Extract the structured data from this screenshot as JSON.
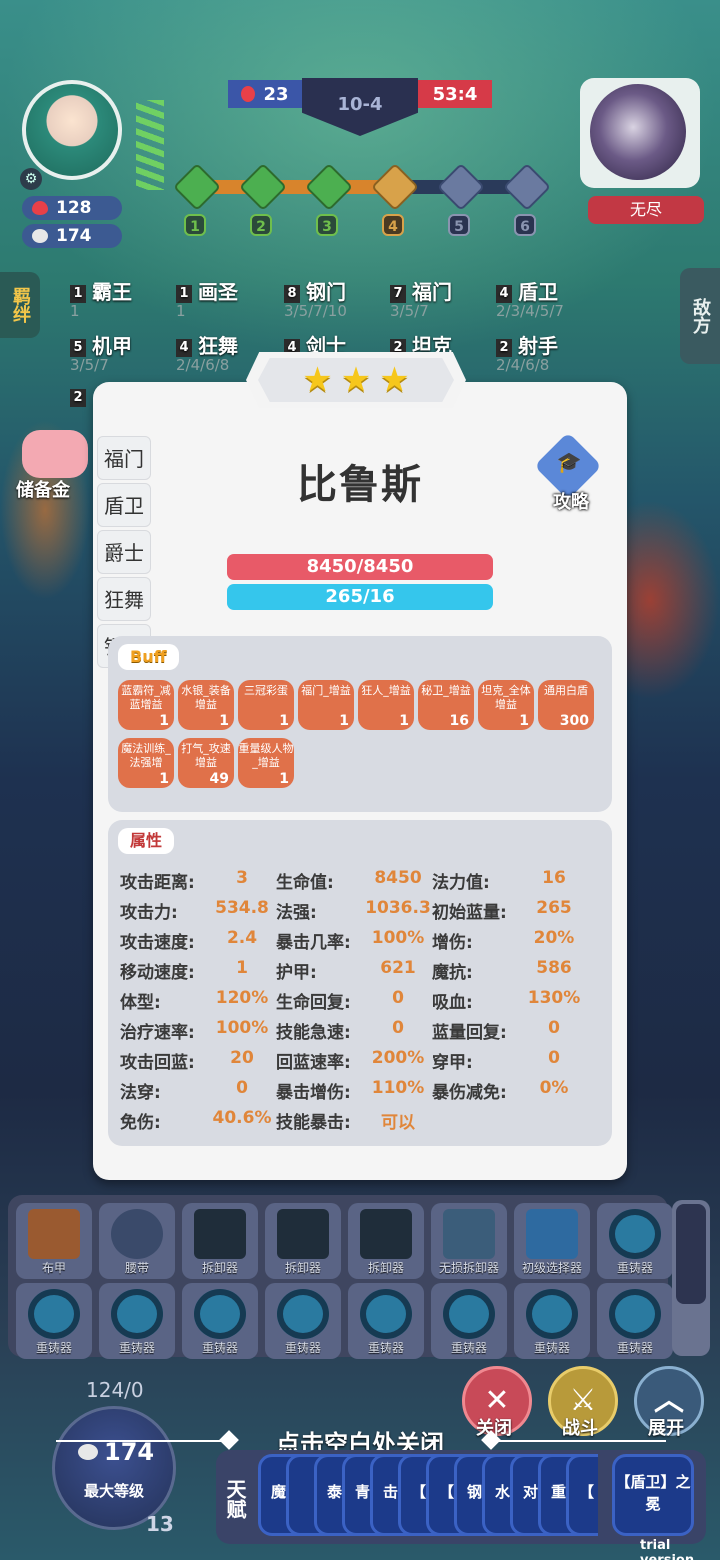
{
  "top": {
    "player": {
      "health": "128",
      "gold": "174"
    },
    "score_left": "23",
    "round": "10-4",
    "score_right": "53:4",
    "stages": [
      "1",
      "2",
      "3",
      "4",
      "5",
      "6"
    ],
    "enemy_name": "无尽"
  },
  "side": {
    "left_label": "羁绊",
    "right_label": "敌方"
  },
  "synergies": [
    {
      "count": "1",
      "name": "霸王",
      "sub": "1"
    },
    {
      "count": "1",
      "name": "画圣",
      "sub": "1"
    },
    {
      "count": "8",
      "name": "钢门",
      "sub": "3/5/7/10"
    },
    {
      "count": "7",
      "name": "福门",
      "sub": "3/5/7"
    },
    {
      "count": "4",
      "name": "盾卫",
      "sub": "2/3/4/5/7"
    },
    {
      "count": "5",
      "name": "机甲",
      "sub": "3/5/7"
    },
    {
      "count": "4",
      "name": "狂舞",
      "sub": "2/4/6/8"
    },
    {
      "count": "4",
      "name": "剑士",
      "sub": ""
    },
    {
      "count": "2",
      "name": "坦克",
      "sub": ""
    },
    {
      "count": "2",
      "name": "射手",
      "sub": "2/4/6/8"
    }
  ],
  "extra_count": "2",
  "piggy_label": "储备金",
  "modal": {
    "tabs": [
      "福门",
      "盾卫",
      "爵士",
      "狂舞",
      "钢门"
    ],
    "hero_name": "比鲁斯",
    "strategy_label": "攻略",
    "hp": "8450/8450",
    "mp": "265/16",
    "buff_title": "Buff",
    "buffs": [
      {
        "name": "蓝霸符_减蓝增益",
        "count": "1"
      },
      {
        "name": "水银_装备增益",
        "count": "1"
      },
      {
        "name": "三冠彩蛋",
        "count": "1"
      },
      {
        "name": "福门_增益",
        "count": "1"
      },
      {
        "name": "狂人_增益",
        "count": "1"
      },
      {
        "name": "秘卫_增益",
        "count": "16"
      },
      {
        "name": "坦克_全体增益",
        "count": "1"
      },
      {
        "name": "通用白盾",
        "count": "300"
      },
      {
        "name": "魔法训练_法强增",
        "count": "1"
      },
      {
        "name": "打气_攻速增益",
        "count": "49"
      },
      {
        "name": "重量级人物_增益",
        "count": "1"
      }
    ],
    "attr_title": "属性",
    "attributes": [
      [
        {
          "k": "攻击距离:",
          "v": "3"
        },
        {
          "k": "生命值:",
          "v": "8450"
        },
        {
          "k": "法力值:",
          "v": "16"
        }
      ],
      [
        {
          "k": "攻击力:",
          "v": "534.8"
        },
        {
          "k": "法强:",
          "v": "1036.3"
        },
        {
          "k": "初始蓝量:",
          "v": "265"
        }
      ],
      [
        {
          "k": "攻击速度:",
          "v": "2.4"
        },
        {
          "k": "暴击几率:",
          "v": "100%"
        },
        {
          "k": "增伤:",
          "v": "20%"
        }
      ],
      [
        {
          "k": "移动速度:",
          "v": "1"
        },
        {
          "k": "护甲:",
          "v": "621"
        },
        {
          "k": "魔抗:",
          "v": "586"
        }
      ],
      [
        {
          "k": "体型:",
          "v": "120%"
        },
        {
          "k": "生命回复:",
          "v": "0"
        },
        {
          "k": "吸血:",
          "v": "130%"
        }
      ],
      [
        {
          "k": "治疗速率:",
          "v": "100%"
        },
        {
          "k": "技能急速:",
          "v": "0"
        },
        {
          "k": "蓝量回复:",
          "v": "0"
        }
      ],
      [
        {
          "k": "攻击回蓝:",
          "v": "20"
        },
        {
          "k": "回蓝速率:",
          "v": "200%"
        },
        {
          "k": "穿甲:",
          "v": "0"
        }
      ],
      [
        {
          "k": "法穿:",
          "v": "0"
        },
        {
          "k": "暴击增伤:",
          "v": "110%"
        },
        {
          "k": "暴伤减免:",
          "v": "0%"
        }
      ],
      [
        {
          "k": "免伤:",
          "v": "40.6%"
        },
        {
          "k": "技能暴击:",
          "v": "可以"
        },
        {
          "k": "",
          "v": ""
        }
      ]
    ]
  },
  "bench": [
    {
      "label": "布甲",
      "icon": "armor-icon"
    },
    {
      "label": "腰带",
      "icon": "belt-icon"
    },
    {
      "label": "拆卸器",
      "icon": "remover-icon"
    },
    {
      "label": "拆卸器",
      "icon": "remover-icon"
    },
    {
      "label": "拆卸器",
      "icon": "remover-icon"
    },
    {
      "label": "无损拆卸器",
      "icon": "tools-icon"
    },
    {
      "label": "初级选择器",
      "icon": "selector-icon"
    },
    {
      "label": "重铸器",
      "icon": "gear-icon"
    },
    {
      "label": "重铸器",
      "icon": "gear-icon"
    },
    {
      "label": "重铸器",
      "icon": "gear-icon"
    },
    {
      "label": "重铸器",
      "icon": "gear-icon"
    },
    {
      "label": "重铸器",
      "icon": "gear-icon"
    },
    {
      "label": "重铸器",
      "icon": "gear-icon"
    },
    {
      "label": "重铸器",
      "icon": "gear-icon"
    },
    {
      "label": "重铸器",
      "icon": "gear-icon"
    },
    {
      "label": "重铸器",
      "icon": "gear-icon"
    }
  ],
  "level": {
    "exp": "124/0",
    "gold": "174",
    "label": "最大等级",
    "num": "13"
  },
  "buttons": {
    "close": "关闭",
    "fight": "战斗",
    "expand": "展开"
  },
  "close_hint": "点击空白处关闭",
  "talent": {
    "label": "天赋",
    "cards": [
      "魔",
      "",
      "泰",
      "青",
      "击",
      "【",
      "【",
      "钢",
      "水",
      "对",
      "重",
      "【"
    ],
    "last_card": "【盾卫】之冕"
  },
  "watermark": "trial version"
}
